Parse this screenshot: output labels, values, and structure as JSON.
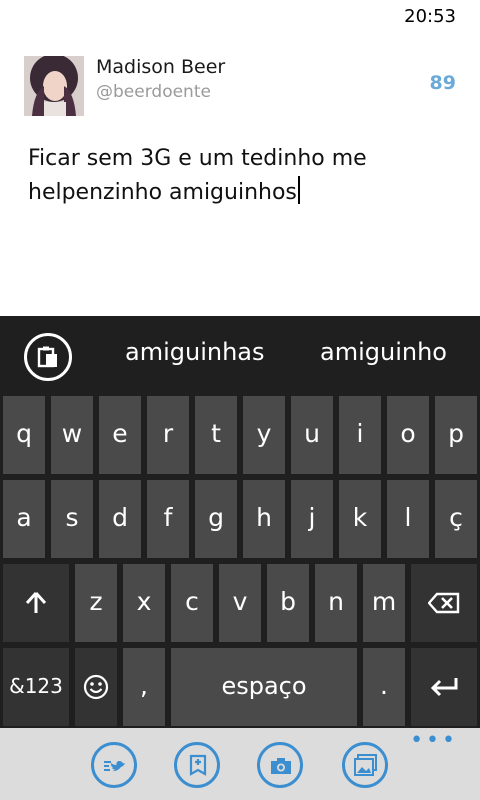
{
  "status_bar": {
    "time": "20:53"
  },
  "account": {
    "name": "Madison Beer",
    "handle": "@beerdoente",
    "chars_remaining": "89"
  },
  "compose": {
    "text": "Ficar sem 3G e um tedinho me\nhelpenzinho amiguinhos"
  },
  "keyboard": {
    "suggestions": [
      "amiguinhas",
      "amiguinho"
    ],
    "row1": [
      "q",
      "w",
      "e",
      "r",
      "t",
      "y",
      "u",
      "i",
      "o",
      "p"
    ],
    "row2": [
      "a",
      "s",
      "d",
      "f",
      "g",
      "h",
      "j",
      "k",
      "l",
      "ç"
    ],
    "row3": [
      "z",
      "x",
      "c",
      "v",
      "b",
      "n",
      "m"
    ],
    "symbols_key": "&123",
    "comma_key": ",",
    "space_key": "espaço",
    "period_key": "."
  },
  "app_bar": {
    "icons": [
      "mention-icon",
      "draft-icon",
      "camera-icon",
      "gallery-icon"
    ],
    "more": "•••",
    "accent_color": "#3b8ed0"
  }
}
